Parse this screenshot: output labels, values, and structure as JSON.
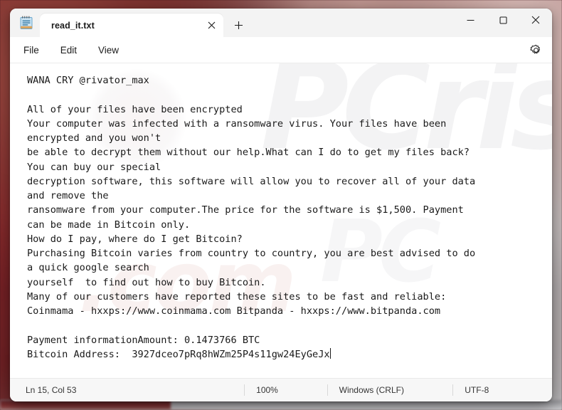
{
  "window": {
    "app_icon": "notepad-icon",
    "controls": {
      "minimize": "minimize-icon",
      "maximize": "maximize-icon",
      "close": "close-icon"
    }
  },
  "tabs": [
    {
      "title": "read_it.txt",
      "close_icon": "close-icon",
      "active": true
    }
  ],
  "newtab": {
    "icon": "plus-icon",
    "label": "+"
  },
  "menubar": {
    "items": [
      {
        "label": "File"
      },
      {
        "label": "Edit"
      },
      {
        "label": "View"
      }
    ],
    "settings_icon": "gear-icon"
  },
  "watermarks": {
    "primary": "PCrisk",
    "secondary": ".com",
    "tertiary": "PC"
  },
  "document": {
    "lines": [
      "WANA CRY @rivator_max",
      "",
      "All of your files have been encrypted",
      "Your computer was infected with a ransomware virus. Your files have been",
      "encrypted and you won't",
      "be able to decrypt them without our help.What can I do to get my files back?",
      "You can buy our special",
      "decryption software, this software will allow you to recover all of your data",
      "and remove the",
      "ransomware from your computer.The price for the software is $1,500. Payment",
      "can be made in Bitcoin only.",
      "How do I pay, where do I get Bitcoin?",
      "Purchasing Bitcoin varies from country to country, you are best advised to do",
      "a quick google search",
      "yourself  to find out how to buy Bitcoin.",
      "Many of our customers have reported these sites to be fast and reliable:",
      "Coinmama - hxxps://www.coinmama.com Bitpanda - hxxps://www.bitpanda.com",
      "",
      "Payment informationAmount: 0.1473766 BTC",
      "Bitcoin Address:  3927dceo7pRq8hWZm25P4s11gw24EyGeJx"
    ],
    "ransom_details": {
      "title": "WANA CRY @rivator_max",
      "contact": "@rivator_max",
      "price_usd": "$1,500",
      "amount_btc": "0.1473766 BTC",
      "bitcoin_address": "3927dceo7pRq8hWZm25P4s11gw24EyGeJx",
      "exchange_sites": [
        "Coinmama - hxxps://www.coinmama.com",
        "Bitpanda - hxxps://www.bitpanda.com"
      ]
    }
  },
  "statusbar": {
    "cursor": "Ln 15, Col 53",
    "zoom": "100%",
    "line_ending": "Windows (CRLF)",
    "encoding": "UTF-8"
  },
  "colors": {
    "window_bg": "#f8f8f8",
    "editor_bg": "#ffffff",
    "text": "#1a1a1a",
    "titlebar": "#f3f3f3",
    "close_hover": "#c42b1c",
    "desktop": "#7a2b2a"
  }
}
